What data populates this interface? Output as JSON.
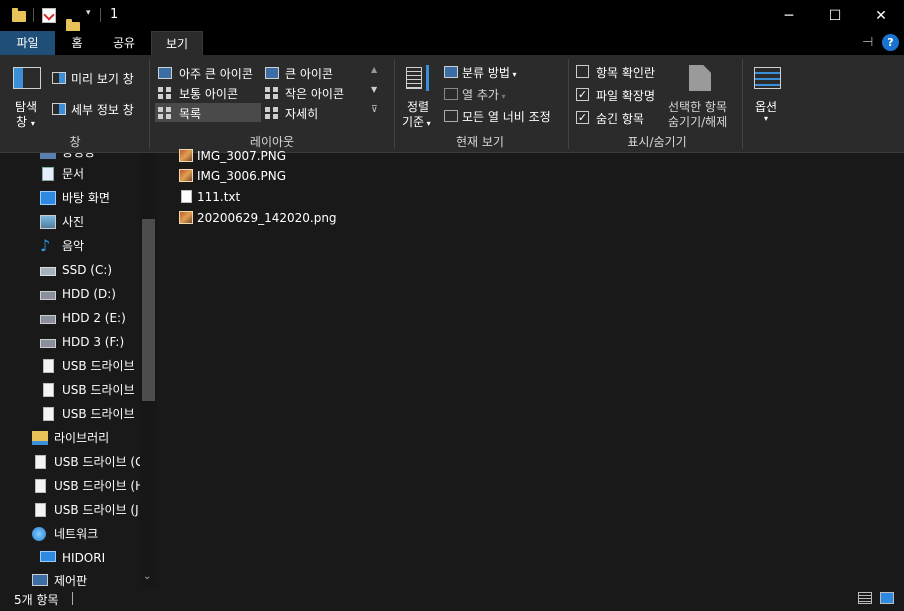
{
  "window": {
    "title": "1",
    "minimize_glyph": "─",
    "maximize_glyph": "☐",
    "close_glyph": "✕"
  },
  "menu": {
    "tabs": [
      "파일",
      "홈",
      "공유",
      "보기"
    ],
    "active_tab": "보기",
    "help_glyph": "?"
  },
  "ribbon": {
    "panes": {
      "navigation_pane": "탐색\n창",
      "navigation_pane_line1": "탐색",
      "navigation_pane_line2": "창",
      "preview_pane": "미리 보기 창",
      "details_pane": "세부 정보 창",
      "group_label": "창"
    },
    "layout": {
      "options": [
        "아주 큰 아이콘",
        "큰 아이콘",
        "보통 아이콘",
        "작은 아이콘",
        "목록",
        "자세히"
      ],
      "selected": "목록",
      "group_label": "레이아웃"
    },
    "current_view": {
      "sort_line1": "정렬",
      "sort_line2": "기준",
      "group_by": "분류 방법",
      "add_columns": "열 추가",
      "size_columns": "모든 열 너비 조정",
      "group_label": "현재 보기"
    },
    "show_hide": {
      "item_checkboxes": "항목 확인란",
      "item_checkboxes_checked": false,
      "file_extensions": "파일 확장명",
      "file_extensions_checked": true,
      "hidden_items": "숨긴 항목",
      "hidden_items_checked": true,
      "hide_selected_line1": "선택한 항목",
      "hide_selected_line2": "숨기기/해제",
      "group_label": "표시/숨기기"
    },
    "options": {
      "label": "옵션"
    }
  },
  "sidebar": {
    "items": [
      {
        "label": "동영상",
        "icon": "video-icon"
      },
      {
        "label": "문서",
        "icon": "documents-icon"
      },
      {
        "label": "바탕 화면",
        "icon": "desktop-icon"
      },
      {
        "label": "사진",
        "icon": "pictures-icon"
      },
      {
        "label": "음악",
        "icon": "music-icon"
      },
      {
        "label": "SSD (C:)",
        "icon": "drive-icon"
      },
      {
        "label": "HDD (D:)",
        "icon": "drive-icon"
      },
      {
        "label": "HDD 2 (E:)",
        "icon": "drive-icon"
      },
      {
        "label": "HDD 3 (F:)",
        "icon": "drive-icon"
      },
      {
        "label": "USB 드라이브",
        "icon": "usb-icon"
      },
      {
        "label": "USB 드라이브",
        "icon": "usb-icon"
      },
      {
        "label": "USB 드라이브",
        "icon": "usb-icon"
      },
      {
        "label": "라이브러리",
        "icon": "library-icon"
      },
      {
        "label": "USB 드라이브 (G",
        "icon": "usb-icon"
      },
      {
        "label": "USB 드라이브 (H",
        "icon": "usb-icon"
      },
      {
        "label": "USB 드라이브 (J",
        "icon": "usb-icon"
      },
      {
        "label": "네트워크",
        "icon": "network-icon"
      },
      {
        "label": "HIDORI",
        "icon": "computer-icon"
      },
      {
        "label": "제어판",
        "icon": "control-panel-icon"
      }
    ]
  },
  "files": [
    {
      "name": "IMG_3007.PNG",
      "type": "image"
    },
    {
      "name": "IMG_3006.PNG",
      "type": "image"
    },
    {
      "name": "111.txt",
      "type": "text"
    },
    {
      "name": "20200629_142020.png",
      "type": "image"
    }
  ],
  "status": {
    "item_count": "5개 항목"
  },
  "colors": {
    "titlebar_bg": "#000000",
    "ribbon_bg": "#2b2b2b",
    "content_bg": "#191919",
    "file_tab_bg": "#1f4e79",
    "accent_blue": "#1a73d0"
  }
}
